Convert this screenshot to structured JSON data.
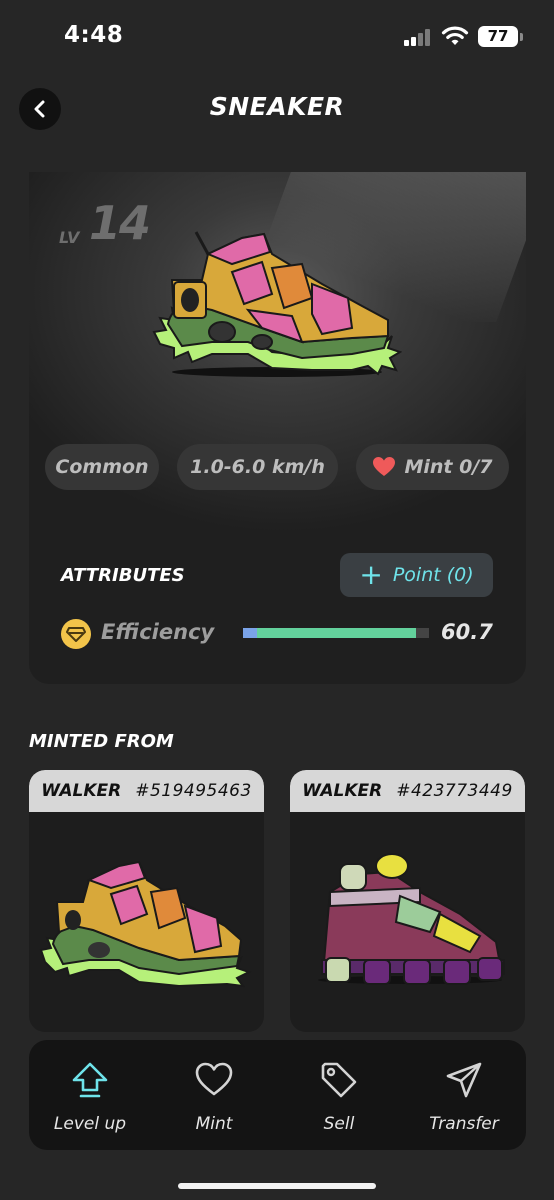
{
  "status_bar": {
    "time": "4:48",
    "battery": "77"
  },
  "header": {
    "title": "SNEAKER"
  },
  "sneaker": {
    "level_prefix": "LV",
    "level": "14",
    "quality": "Common",
    "speed_range": "1.0-6.0 km/h",
    "mint": "Mint 0/7"
  },
  "attributes": {
    "title": "ATTRIBUTES",
    "point_button": "Point (0)",
    "efficiency": {
      "label": "Efficiency",
      "value": "60.7",
      "bar_fraction": 0.93
    }
  },
  "minted_from": {
    "title": "MINTED FROM",
    "parents": [
      {
        "type": "WALKER",
        "id": "#519495463"
      },
      {
        "type": "WALKER",
        "id": "#423773449"
      }
    ]
  },
  "actions": [
    {
      "label": "Level up",
      "icon": "arrow-up-icon"
    },
    {
      "label": "Mint",
      "icon": "heart-icon"
    },
    {
      "label": "Sell",
      "icon": "tag-icon"
    },
    {
      "label": "Transfer",
      "icon": "send-icon"
    }
  ],
  "colors": {
    "accent": "#6fe3ea",
    "efficiency_bar": "#63d19c",
    "efficiency_icon": "#f2c44a",
    "mint_heart": "#ef5a5a"
  }
}
